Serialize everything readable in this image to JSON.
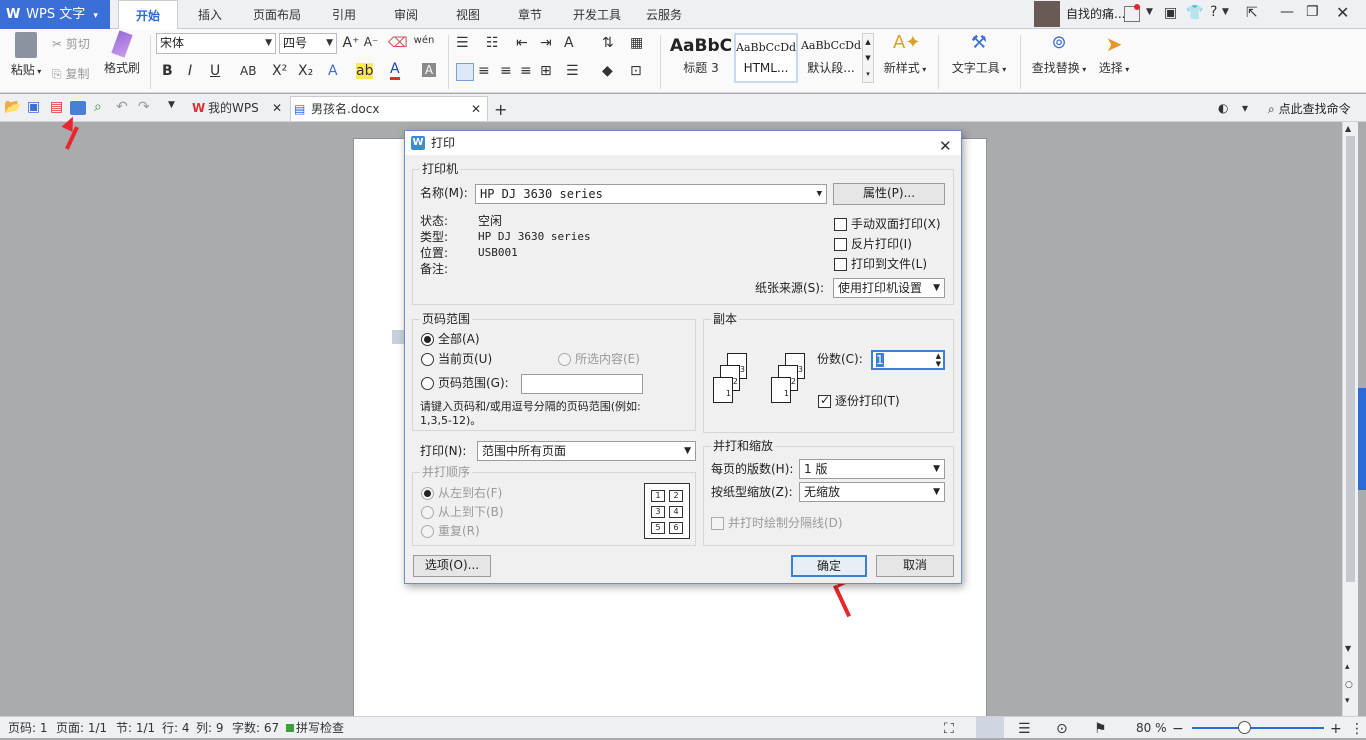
{
  "titlebar": {
    "app_name": "WPS 文字",
    "tabs": [
      "开始",
      "插入",
      "页面布局",
      "引用",
      "审阅",
      "视图",
      "章节",
      "开发工具",
      "云服务"
    ],
    "active_tab": "开始",
    "user_name": "自找的痛...",
    "help": "?"
  },
  "ribbon": {
    "paste": "粘贴",
    "cut": "剪切",
    "copy": "复制",
    "format_painter": "格式刷",
    "font_name": "宋体",
    "font_size": "四号",
    "style_heading3": "标题 3",
    "style_heading3_sample": "AaBbC",
    "style_html": "HTML...",
    "style_html_sample": "AaBbCcDd",
    "style_default": "默认段...",
    "style_default_sample": "AaBbCcDd",
    "new_style": "新样式",
    "text_tools": "文字工具",
    "find_replace": "查找替换",
    "select": "选择"
  },
  "tabs": {
    "my_wps": "我的WPS",
    "document": "男孩名.docx",
    "search_cmd": "点此查找命令"
  },
  "dialog": {
    "title": "打印",
    "printer_group": "打印机",
    "name_label": "名称(M):",
    "printer_name": "HP DJ 3630 series",
    "properties_btn": "属性(P)...",
    "status_label": "状态:",
    "status_value": "空闲",
    "type_label": "类型:",
    "type_value": "HP DJ 3630 series",
    "location_label": "位置:",
    "location_value": "USB001",
    "comment_label": "备注:",
    "manual_duplex": "手动双面打印(X)",
    "reverse": "反片打印(I)",
    "print_to_file": "打印到文件(L)",
    "paper_source_label": "纸张来源(S):",
    "paper_source_value": "使用打印机设置",
    "range_group": "页码范围",
    "all": "全部(A)",
    "current": "当前页(U)",
    "selection": "所选内容(E)",
    "pages": "页码范围(G):",
    "pages_value": "",
    "range_hint": "请键入页码和/或用逗号分隔的页码范围(例如:",
    "range_hint2": "1,3,5-12)。",
    "copies_group": "副本",
    "copies_label": "份数(C):",
    "copies_value": "1",
    "collate": "逐份打印(T)",
    "print_label": "打印(N):",
    "print_value": "范围中所有页面",
    "order_group": "并打顺序",
    "order_lr": "从左到右(F)",
    "order_tb": "从上到下(B)",
    "order_repeat": "重复(R)",
    "zoom_group": "并打和缩放",
    "pages_per_sheet_label": "每页的版数(H):",
    "pages_per_sheet_value": "1 版",
    "scale_label": "按纸型缩放(Z):",
    "scale_value": "无缩放",
    "draw_borders": "并打时绘制分隔线(D)",
    "options_btn": "选项(O)...",
    "ok_btn": "确定",
    "cancel_btn": "取消",
    "layout_nums": [
      "1",
      "2",
      "3",
      "4",
      "5",
      "6"
    ]
  },
  "status": {
    "page": "页码: 1",
    "pages": "页面: 1/1",
    "section": "节: 1/1",
    "row": "行: 4",
    "col": "列: 9",
    "words": "字数: 67",
    "spell": "拼写检查",
    "zoom": "80 %"
  },
  "colors": {
    "accent": "#2a6bd6",
    "arrow": "#e8262b"
  }
}
